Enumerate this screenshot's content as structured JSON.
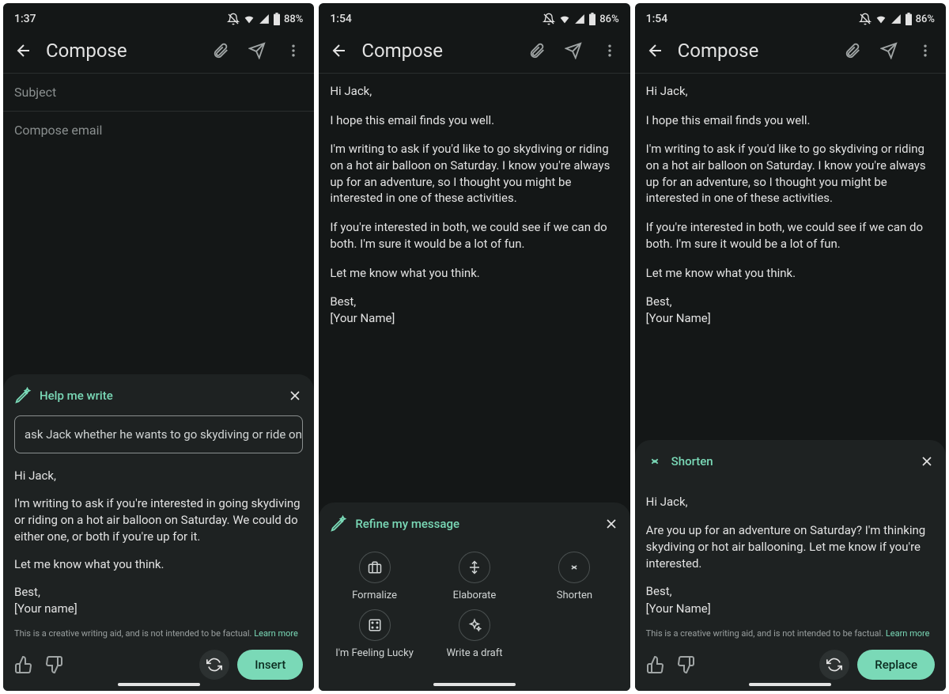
{
  "statusbar": {
    "time1": "1:37",
    "time2": "1:54",
    "time3": "1:54",
    "battery1": "88%",
    "battery2": "86%",
    "battery3": "86%"
  },
  "compose_title": "Compose",
  "subject_placeholder": "Subject",
  "body_placeholder": "Compose email",
  "email": {
    "greeting": "Hi Jack,",
    "intro": "I hope this email finds you well.",
    "p1": "I'm writing to ask if you'd like to go skydiving or riding on a hot air balloon on Saturday. I know you're always up for an adventure, so I thought you might be interested in one of these activities.",
    "p2": "If you're interested in both, we could see if we can do both. I'm sure it would be a lot of fun.",
    "p3": "Let me know what you think.",
    "signoff": "Best,",
    "name": "[Your Name]"
  },
  "hmw": {
    "title": "Help me write",
    "prompt": "ask Jack whether he wants to go skydiving or ride on a",
    "greeting": "Hi Jack,",
    "body": "I'm writing to ask if you're interested in going skydiving or riding on a hot air balloon on Saturday. We could do either one, or both if you're up for it.",
    "closing": "Let me know what you think.",
    "signoff": "Best,",
    "name": "[Your name]",
    "disclaimer_text": "This is a creative writing aid, and is not intended to be factual. ",
    "learn_more": "Learn more",
    "insert": "Insert"
  },
  "refine": {
    "title": "Refine my message",
    "formalize": "Formalize",
    "elaborate": "Elaborate",
    "shorten": "Shorten",
    "lucky": "I'm Feeling Lucky",
    "draft": "Write a draft"
  },
  "shorten": {
    "title": "Shorten",
    "greeting": "Hi Jack,",
    "body": "Are you up for an adventure on Saturday? I'm thinking skydiving or hot air ballooning. Let me know if you're interested.",
    "signoff": "Best,",
    "name": "[Your Name]",
    "disclaimer_text": "This is a creative writing aid, and is not intended to be factual. ",
    "learn_more": "Learn more",
    "replace": "Replace"
  }
}
